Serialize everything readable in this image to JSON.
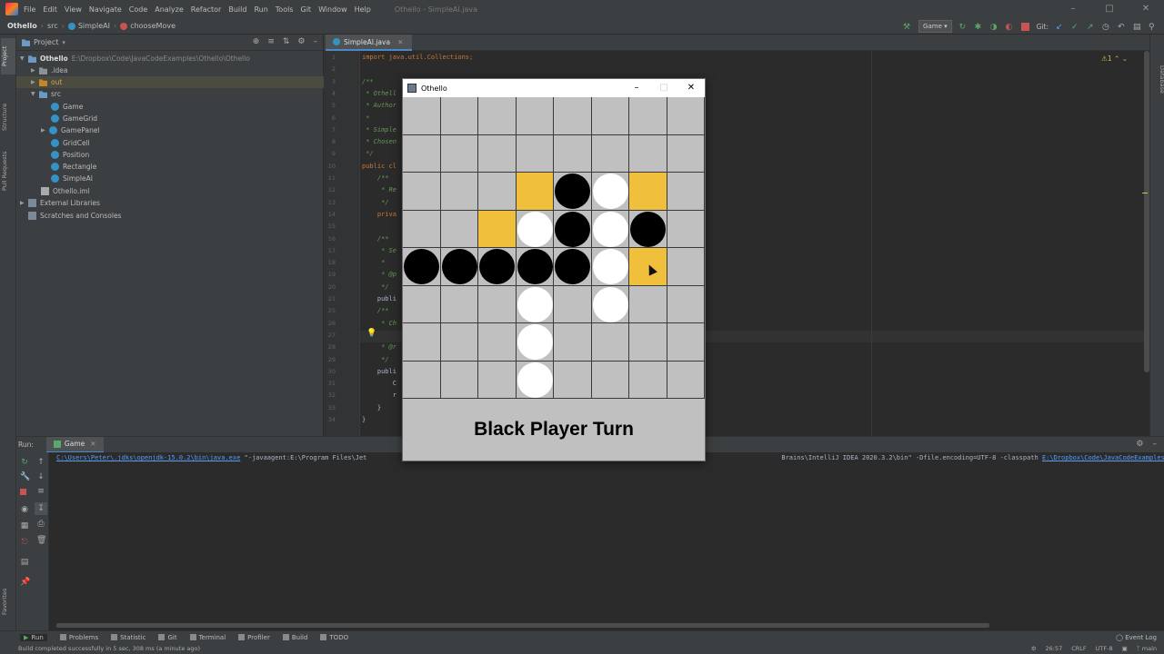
{
  "menubar": {
    "items": [
      "File",
      "Edit",
      "View",
      "Navigate",
      "Code",
      "Analyze",
      "Refactor",
      "Build",
      "Run",
      "Tools",
      "Git",
      "Window",
      "Help"
    ],
    "window_title": "Othello - SimpleAI.java"
  },
  "navbar": {
    "project": "Othello",
    "folder": "src",
    "file": "SimpleAI",
    "method": "chooseMove",
    "run_config": "Game",
    "git_label": "Git:"
  },
  "project_panel": {
    "title": "Project",
    "root_name": "Othello",
    "root_path": "E:\\Dropbox\\Code\\JavaCodeExamples\\Othello\\Othello",
    "items": {
      "idea": ".idea",
      "out": "out",
      "src": "src",
      "game": "Game",
      "gamegrid": "GameGrid",
      "gamepanel": "GamePanel",
      "gridcell": "GridCell",
      "position": "Position",
      "rectangle": "Rectangle",
      "simpleai": "SimpleAI",
      "iml": "Othello.iml",
      "ext_libs": "External Libraries",
      "scratches": "Scratches and Consoles"
    }
  },
  "editor": {
    "tab_label": "SimpleAI.java",
    "warning": "1",
    "line_numbers": [
      "1",
      "2",
      "3",
      "4",
      "5",
      "6",
      "7",
      "8",
      "9",
      "10",
      "11",
      "12",
      "13",
      "14",
      "15",
      "16",
      "17",
      "18",
      "19",
      "20",
      "21",
      "25",
      "26",
      "27",
      "28",
      "29",
      "30",
      "31",
      "32",
      "33",
      "34"
    ],
    "code": {
      "l1": "import java.util.Collections;",
      "l3": "/**",
      "l4": " * Othell",
      "l5": " * Author",
      "l6": " *",
      "l7": " * Simple",
      "l8": " * Chosen",
      "l9": " */",
      "l10": "public cl",
      "l11": "    /**",
      "l12": "     * Re",
      "l13": "     */",
      "l14": "    priva",
      "l16": "    /**",
      "l17": "     * Se",
      "l18": "     *",
      "l19": "     * @p",
      "l20": "     */",
      "l21": "    publi",
      "l25": "    /**",
      "l26": "     * Ch",
      "l27": "     *",
      "l28": "     * @r",
      "l29": "     */",
      "l30": "    publi",
      "l31": "        C",
      "l32": "        r",
      "l33": "    }",
      "l34": "}"
    }
  },
  "run_panel": {
    "label": "Run:",
    "tab": "Game",
    "console": {
      "path_link": "C:\\Users\\Peter\\.jdks\\openjdk-15.0.2\\bin\\java.exe",
      "args": " \"-javaagent:E:\\Program Files\\Jet",
      "args_tail": "Brains\\IntelliJ IDEA 2020.3.2\\bin\" -Dfile.encoding=UTF-8 -classpath ",
      "classpath_link": "E:\\Dropbox\\Code\\JavaCodeExamples\\Oth"
    }
  },
  "bottom_tabs": [
    "Run",
    "Problems",
    "Statistic",
    "Git",
    "Terminal",
    "Profiler",
    "Build",
    "TODO"
  ],
  "event_log": "Event Log",
  "statusbar": {
    "message": "Build completed successfully in 5 sec, 308 ms (a minute ago)",
    "position": "26:57",
    "line_sep": "CRLF",
    "encoding": "UTF-8",
    "branch": "main"
  },
  "left_stripe": {
    "project": "Project",
    "structure": "Structure",
    "pull_requests": "Pull Requests",
    "favorites": "Favorites"
  },
  "right_stripe": {
    "database": "Database"
  },
  "othello": {
    "window_title": "Othello",
    "turn_text": "Black Player Turn",
    "board": [
      [
        "",
        "",
        "",
        "",
        "",
        "",
        "",
        ""
      ],
      [
        "",
        "",
        "",
        "",
        "",
        "",
        "",
        ""
      ],
      [
        "",
        "",
        "",
        "M",
        "B",
        "W",
        "M",
        ""
      ],
      [
        "",
        "",
        "M",
        "W",
        "B",
        "W",
        "B",
        ""
      ],
      [
        "B",
        "B",
        "B",
        "B",
        "B",
        "W",
        "M",
        ""
      ],
      [
        "",
        "",
        "",
        "W",
        "",
        "W",
        "",
        ""
      ],
      [
        "",
        "",
        "",
        "W",
        "",
        "",
        "",
        ""
      ],
      [
        "",
        "",
        "",
        "W",
        "",
        "",
        "",
        ""
      ]
    ],
    "colors": {
      "board": "#c0c0c0",
      "move_highlight": "#f0bf3c",
      "black": "#000000",
      "white": "#ffffff"
    }
  }
}
